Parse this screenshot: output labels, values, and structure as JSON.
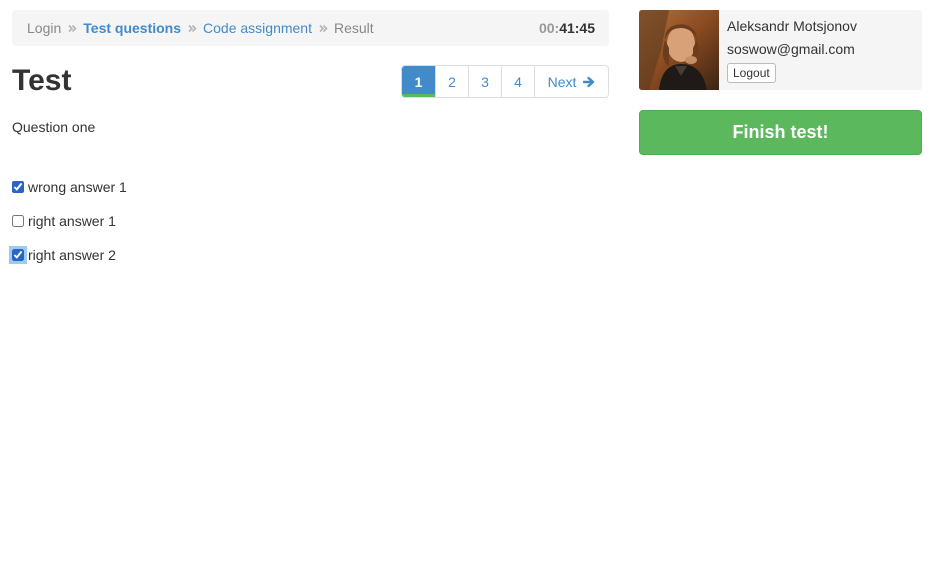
{
  "breadcrumb": {
    "items": [
      {
        "label": "Login",
        "state": "done"
      },
      {
        "label": "Test questions",
        "state": "active"
      },
      {
        "label": "Code assignment",
        "state": "link"
      },
      {
        "label": "Result",
        "state": "pending"
      }
    ],
    "timer": {
      "minutes_prefix": "00:",
      "time": "41:45"
    }
  },
  "page": {
    "title": "Test"
  },
  "pagination": {
    "pages": [
      "1",
      "2",
      "3",
      "4"
    ],
    "active_page": "1",
    "next_label": "Next"
  },
  "question": {
    "text": "Question one",
    "answers": [
      {
        "label": "wrong answer 1",
        "checked": true
      },
      {
        "label": "right answer 1",
        "checked": false
      },
      {
        "label": "right answer 2",
        "checked": true
      }
    ]
  },
  "user": {
    "name": "Aleksandr Motsjonov",
    "email": "soswow@gmail.com",
    "logout_label": "Logout"
  },
  "actions": {
    "finish_label": "Finish test!"
  },
  "colors": {
    "link": "#428bca",
    "active_page_bg": "#428bca",
    "progress_green": "#5cb85c",
    "finish_bg": "#5cb85c",
    "panel_bg": "#f5f5f5"
  }
}
